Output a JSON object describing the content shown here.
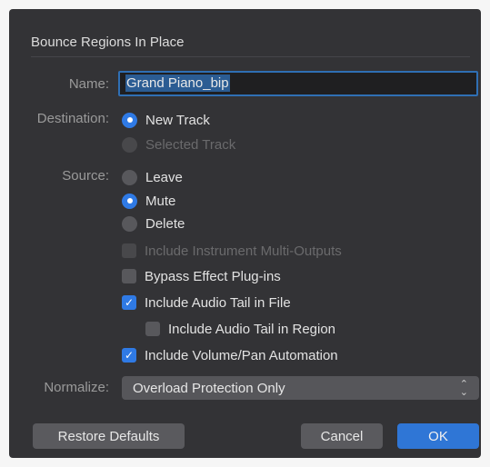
{
  "dialog": {
    "title": "Bounce Regions In Place"
  },
  "name": {
    "label": "Name:",
    "value": "Grand Piano_bip"
  },
  "destination": {
    "label": "Destination:",
    "options": [
      {
        "label": "New Track",
        "selected": true,
        "enabled": true
      },
      {
        "label": "Selected Track",
        "selected": false,
        "enabled": false
      }
    ]
  },
  "source": {
    "label": "Source:",
    "options": [
      {
        "label": "Leave",
        "selected": false
      },
      {
        "label": "Mute",
        "selected": true
      },
      {
        "label": "Delete",
        "selected": false
      }
    ]
  },
  "checkboxes": [
    {
      "label": "Include Instrument Multi-Outputs",
      "checked": false,
      "enabled": false
    },
    {
      "label": "Bypass Effect Plug-ins",
      "checked": false,
      "enabled": true
    },
    {
      "label": "Include Audio Tail in File",
      "checked": true,
      "enabled": true
    },
    {
      "label": "Include Audio Tail in Region",
      "checked": false,
      "enabled": true
    },
    {
      "label": "Include Volume/Pan Automation",
      "checked": true,
      "enabled": true
    }
  ],
  "normalize": {
    "label": "Normalize:",
    "value": "Overload Protection Only"
  },
  "buttons": {
    "restore": "Restore Defaults",
    "cancel": "Cancel",
    "ok": "OK"
  },
  "colors": {
    "dialog_bg": "#333336",
    "accent": "#2f7ae5",
    "control": "#58585c"
  }
}
